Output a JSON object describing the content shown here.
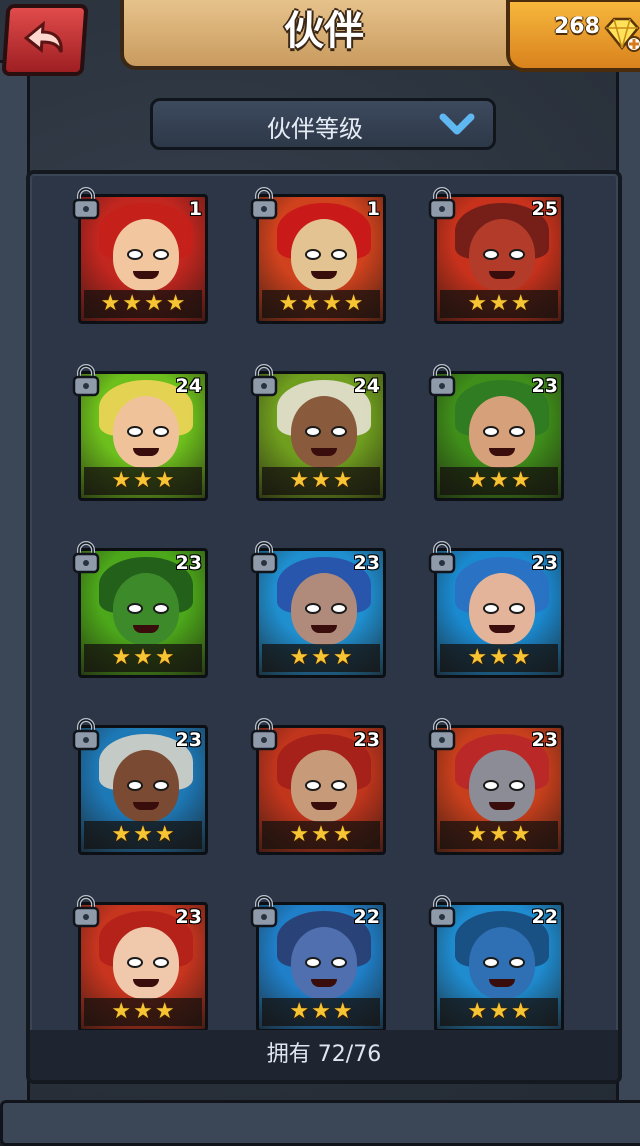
{
  "header": {
    "title": "伙伴",
    "back_icon": "back-arrow-icon",
    "gems": "268",
    "gem_icon": "diamond-plus-icon"
  },
  "sort": {
    "label": "伙伴等级",
    "icon": "chevron-down-icon"
  },
  "companions": [
    {
      "level": "1",
      "stars": 4,
      "bg": "#c1261f",
      "skin": "#f2c7a0",
      "hair": "#c5201a"
    },
    {
      "level": "1",
      "stars": 4,
      "bg": "#d0421d",
      "skin": "#e2c391",
      "hair": "#c8161a"
    },
    {
      "level": "25",
      "stars": 3,
      "bg": "#c8321c",
      "skin": "#b23b2a",
      "hair": "#6d1d19"
    },
    {
      "level": "24",
      "stars": 3,
      "bg": "#6cbf1c",
      "skin": "#f0c29a",
      "hair": "#f2d45a"
    },
    {
      "level": "24",
      "stars": 3,
      "bg": "#6f9e1e",
      "skin": "#8a5a3c",
      "hair": "#e6e1d3"
    },
    {
      "level": "23",
      "stars": 3,
      "bg": "#3f8e1a",
      "skin": "#d6a07a",
      "hair": "#2f7a24"
    },
    {
      "level": "23",
      "stars": 3,
      "bg": "#4ca71a",
      "skin": "#3d8a2a",
      "hair": "#1f5a1c"
    },
    {
      "level": "23",
      "stars": 3,
      "bg": "#1f8fd0",
      "skin": "#b08a7a",
      "hair": "#2a50a8"
    },
    {
      "level": "23",
      "stars": 3,
      "bg": "#1a8ad0",
      "skin": "#e3b49a",
      "hair": "#2c6fc2"
    },
    {
      "level": "23",
      "stars": 3,
      "bg": "#1d78b6",
      "skin": "#7a4a32",
      "hair": "#d7d3c8"
    },
    {
      "level": "23",
      "stars": 3,
      "bg": "#c1351c",
      "skin": "#c79a7a",
      "hair": "#a21f1a"
    },
    {
      "level": "23",
      "stars": 3,
      "bg": "#c73f1c",
      "skin": "#8c8c96",
      "hair": "#b8272a"
    },
    {
      "level": "23",
      "stars": 3,
      "bg": "#c8351f",
      "skin": "#f0c9ad",
      "hair": "#b3201a"
    },
    {
      "level": "22",
      "stars": 3,
      "bg": "#1f7fc8",
      "skin": "#4f6fae",
      "hair": "#2a3c6e"
    },
    {
      "level": "22",
      "stars": 3,
      "bg": "#1f8cd0",
      "skin": "#2f70b4",
      "hair": "#1a4a7c"
    }
  ],
  "lock_icon": "padlock-icon",
  "star_icon": "star-icon",
  "footer": {
    "owned_label": "拥有 72/76"
  }
}
